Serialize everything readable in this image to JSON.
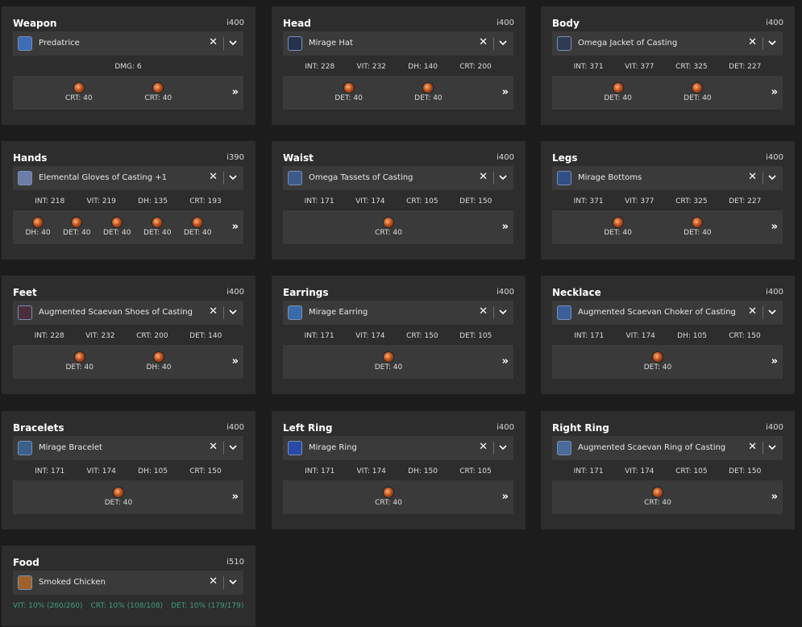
{
  "cards": [
    {
      "key": "weapon",
      "title": "Weapon",
      "ilvl": "i400",
      "item": "Predatrice",
      "icon_color": "#3d6db5",
      "stats": [
        "DMG: 6"
      ],
      "melds": [
        "CRT: 40",
        "CRT: 40"
      ]
    },
    {
      "key": "head",
      "title": "Head",
      "ilvl": "i400",
      "item": "Mirage Hat",
      "icon_color": "#26324a",
      "stats": [
        "INT: 228",
        "VIT: 232",
        "DH: 140",
        "CRT: 200"
      ],
      "melds": [
        "DET: 40",
        "DET: 40"
      ]
    },
    {
      "key": "body",
      "title": "Body",
      "ilvl": "i400",
      "item": "Omega Jacket of Casting",
      "icon_color": "#2f3b55",
      "stats": [
        "INT: 371",
        "VIT: 377",
        "CRT: 325",
        "DET: 227"
      ],
      "melds": [
        "DET: 40",
        "DET: 40"
      ]
    },
    {
      "key": "hands",
      "title": "Hands",
      "ilvl": "i390",
      "item": "Elemental Gloves of Casting +1",
      "icon_color": "#6c7ea8",
      "stats": [
        "INT: 218",
        "VIT: 219",
        "DH: 135",
        "CRT: 193"
      ],
      "melds": [
        "DH: 40",
        "DET: 40",
        "DET: 40",
        "DET: 40",
        "DET: 40"
      ]
    },
    {
      "key": "waist",
      "title": "Waist",
      "ilvl": "i400",
      "item": "Omega Tassets of Casting",
      "icon_color": "#3d5a8a",
      "stats": [
        "INT: 171",
        "VIT: 174",
        "CRT: 105",
        "DET: 150"
      ],
      "melds": [
        "CRT: 40"
      ]
    },
    {
      "key": "legs",
      "title": "Legs",
      "ilvl": "i400",
      "item": "Mirage Bottoms",
      "icon_color": "#2f4f86",
      "stats": [
        "INT: 371",
        "VIT: 377",
        "CRT: 325",
        "DET: 227"
      ],
      "melds": [
        "DET: 40",
        "DET: 40"
      ]
    },
    {
      "key": "feet",
      "title": "Feet",
      "ilvl": "i400",
      "item": "Augmented Scaevan Shoes of Casting",
      "icon_color": "#4a2f3a",
      "stats": [
        "INT: 228",
        "VIT: 232",
        "CRT: 200",
        "DET: 140"
      ],
      "melds": [
        "DET: 40",
        "DH: 40"
      ]
    },
    {
      "key": "earrings",
      "title": "Earrings",
      "ilvl": "i400",
      "item": "Mirage Earring",
      "icon_color": "#3a6aa8",
      "stats": [
        "INT: 171",
        "VIT: 174",
        "CRT: 150",
        "DET: 105"
      ],
      "melds": [
        "DET: 40"
      ]
    },
    {
      "key": "necklace",
      "title": "Necklace",
      "ilvl": "i400",
      "item": "Augmented Scaevan Choker of Casting",
      "icon_color": "#3a5f9a",
      "stats": [
        "INT: 171",
        "VIT: 174",
        "DH: 105",
        "CRT: 150"
      ],
      "melds": [
        "DET: 40"
      ]
    },
    {
      "key": "bracelets",
      "title": "Bracelets",
      "ilvl": "i400",
      "item": "Mirage Bracelet",
      "icon_color": "#3a5f8a",
      "stats": [
        "INT: 171",
        "VIT: 174",
        "DH: 105",
        "CRT: 150"
      ],
      "melds": [
        "DET: 40"
      ]
    },
    {
      "key": "left_ring",
      "title": "Left Ring",
      "ilvl": "i400",
      "item": "Mirage Ring",
      "icon_color": "#2a4aa8",
      "stats": [
        "INT: 171",
        "VIT: 174",
        "DH: 150",
        "CRT: 105"
      ],
      "melds": [
        "CRT: 40"
      ]
    },
    {
      "key": "right_ring",
      "title": "Right Ring",
      "ilvl": "i400",
      "item": "Augmented Scaevan Ring of Casting",
      "icon_color": "#4a6a9a",
      "stats": [
        "INT: 171",
        "VIT: 174",
        "CRT: 105",
        "DET: 150"
      ],
      "melds": [
        "CRT: 40"
      ]
    }
  ],
  "food": {
    "title": "Food",
    "ilvl": "i510",
    "item": "Smoked Chicken",
    "icon_color": "#a0602a",
    "effects": [
      "VIT: 10% (260/260)",
      "CRT: 10% (108/108)",
      "DET: 10% (179/179)"
    ]
  },
  "ui": {
    "clear_glyph": "✕",
    "more_glyph": "»"
  },
  "colors": {
    "meld_accent": "#c0521c",
    "food_effect": "#3f9f7f"
  }
}
